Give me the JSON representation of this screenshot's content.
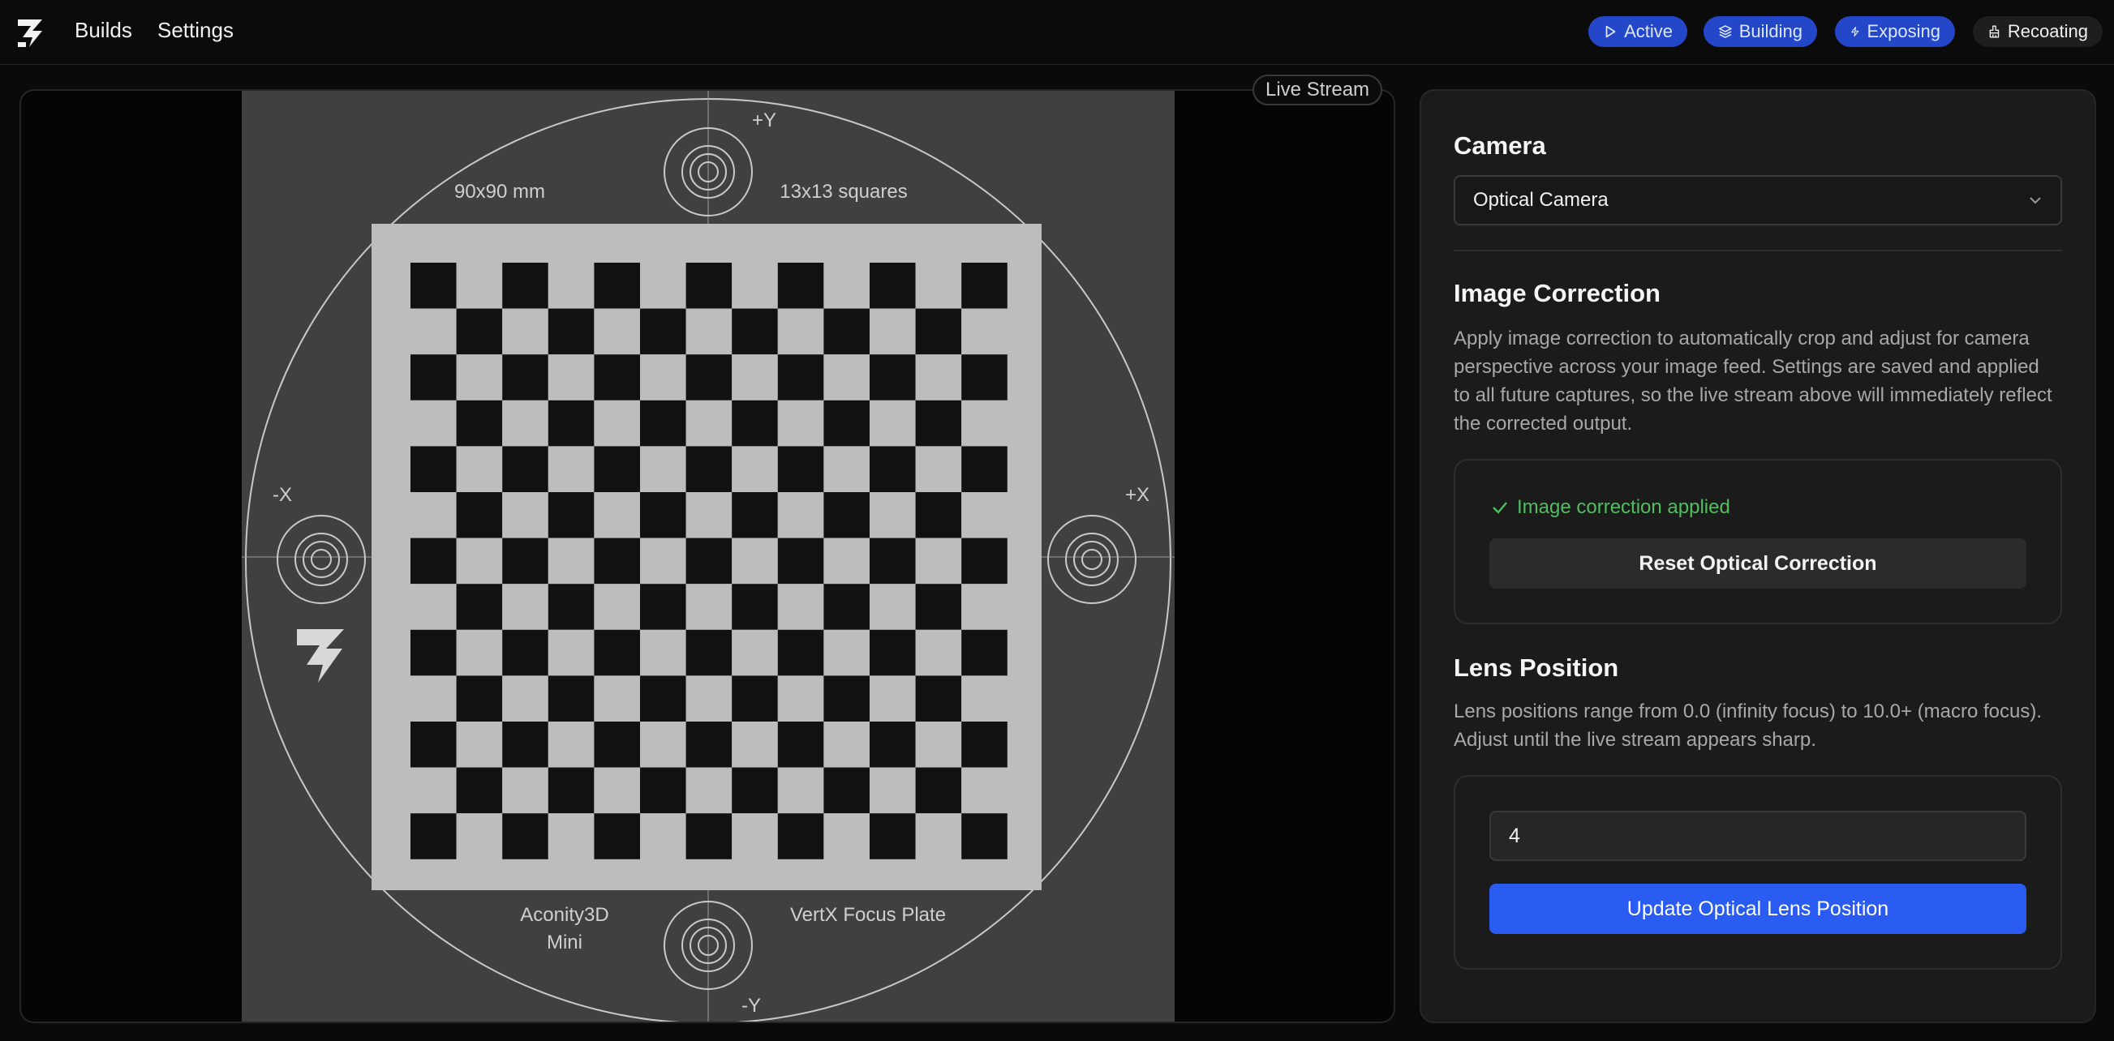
{
  "nav": {
    "builds": "Builds",
    "settings": "Settings"
  },
  "status": {
    "active": "Active",
    "building": "Building",
    "exposing": "Exposing",
    "recoating": "Recoating"
  },
  "stream": {
    "label": "Live Stream",
    "plate": {
      "size": "90x90 mm",
      "squares": "13x13 squares",
      "axis_py": "+Y",
      "axis_ny": "-Y",
      "axis_px": "+X",
      "axis_nx": "-X",
      "machine_line1": "Aconity3D",
      "machine_line2": "Mini",
      "plate_name": "VertX Focus Plate"
    }
  },
  "camera": {
    "heading": "Camera",
    "selected": "Optical Camera"
  },
  "correction": {
    "heading": "Image Correction",
    "description": "Apply image correction to automatically crop and adjust for camera perspective across your image feed. Settings are saved and applied to all future captures, so the live stream above will immediately reflect the corrected output.",
    "status": "Image correction applied",
    "reset_button": "Reset Optical Correction"
  },
  "lens": {
    "heading": "Lens Position",
    "description": "Lens positions range from 0.0 (infinity focus) to 10.0+ (macro focus). Adjust until the live stream appears sharp.",
    "value": "4",
    "update_button": "Update Optical Lens Position"
  },
  "colors": {
    "accent": "#2b5cf2",
    "status_pill": "#2347c8",
    "success": "#4fbf5f"
  }
}
